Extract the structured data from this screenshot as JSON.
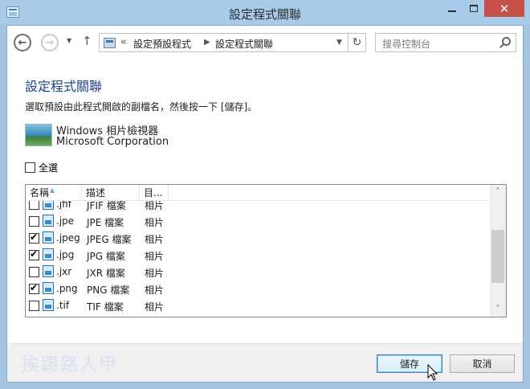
{
  "window": {
    "title": "設定程式關聯",
    "close_glyph": "✕"
  },
  "address_bar": {
    "back_glyph": "←",
    "forward_glyph": "→",
    "up_glyph": "↑",
    "separator": "«",
    "crumbs": [
      "設定預設程式",
      "設定程式關聯"
    ],
    "crumb_arrow": "▶",
    "dropdown_glyph": "▼",
    "refresh_glyph": "↻",
    "search_placeholder": "搜尋控制台"
  },
  "page": {
    "title": "設定程式關聯",
    "instruction": "選取預設由此程式開啟的副檔名，然後按一下 [儲存]。"
  },
  "program": {
    "name": "Windows 相片檢視器",
    "company": "Microsoft Corporation"
  },
  "select_all": {
    "label": "全選",
    "checked": false
  },
  "list": {
    "columns": [
      "名稱",
      "描述",
      "目..."
    ],
    "rows": [
      {
        "ext": ".jfif",
        "desc": "JFIF 檔案",
        "cat": "相片",
        "checked": false
      },
      {
        "ext": ".jpe",
        "desc": "JPE 檔案",
        "cat": "相片",
        "checked": false
      },
      {
        "ext": ".jpeg",
        "desc": "JPEG 檔案",
        "cat": "相片",
        "checked": true
      },
      {
        "ext": ".jpg",
        "desc": "JPG 檔案",
        "cat": "相片",
        "checked": true
      },
      {
        "ext": ".jxr",
        "desc": "JXR 檔案",
        "cat": "相片",
        "checked": false
      },
      {
        "ext": ".png",
        "desc": "PNG 檔案",
        "cat": "相片",
        "checked": true
      },
      {
        "ext": ".tif",
        "desc": "TIF 檔案",
        "cat": "相片",
        "checked": false
      }
    ],
    "scroll_up_glyph": "˄",
    "scroll_down_glyph": "˅"
  },
  "footer": {
    "watermark": "挨踢路人甲",
    "save_label": "儲存",
    "cancel_label": "取消"
  },
  "icons": [
    "app-icon",
    "back-icon",
    "forward-icon",
    "up-icon",
    "control-panel-icon",
    "refresh-icon",
    "search-icon",
    "photo-viewer-icon",
    "image-file-icon",
    "mouse-cursor-icon"
  ],
  "colors": {
    "title_bar": "#a9cbea",
    "close_button": "#c7504b",
    "page_title": "#1e3f8a",
    "save_button_border": "#3c7fb1"
  }
}
